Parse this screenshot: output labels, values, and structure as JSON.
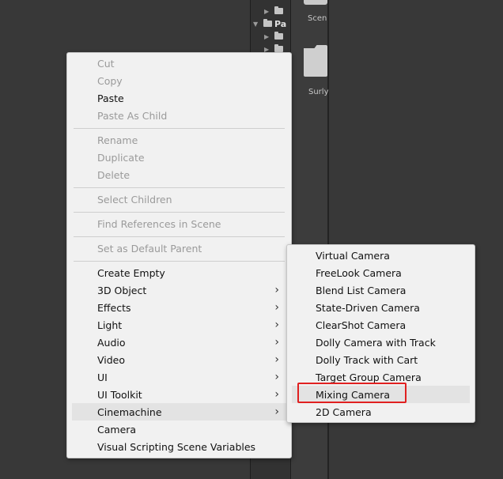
{
  "hierarchy": {
    "partial_label": "Pa"
  },
  "assets": {
    "items": [
      {
        "label": "Scen"
      },
      {
        "label": "Surly"
      }
    ]
  },
  "context_menu": {
    "groups": [
      [
        {
          "label": "Cut",
          "enabled": false
        },
        {
          "label": "Copy",
          "enabled": false
        },
        {
          "label": "Paste",
          "enabled": true
        },
        {
          "label": "Paste As Child",
          "enabled": false
        }
      ],
      [
        {
          "label": "Rename",
          "enabled": false
        },
        {
          "label": "Duplicate",
          "enabled": false
        },
        {
          "label": "Delete",
          "enabled": false
        }
      ],
      [
        {
          "label": "Select Children",
          "enabled": false
        }
      ],
      [
        {
          "label": "Find References in Scene",
          "enabled": false
        }
      ],
      [
        {
          "label": "Set as Default Parent",
          "enabled": false
        }
      ],
      [
        {
          "label": "Create Empty",
          "enabled": true,
          "submenu": false
        },
        {
          "label": "3D Object",
          "enabled": true,
          "submenu": true
        },
        {
          "label": "Effects",
          "enabled": true,
          "submenu": true
        },
        {
          "label": "Light",
          "enabled": true,
          "submenu": true
        },
        {
          "label": "Audio",
          "enabled": true,
          "submenu": true
        },
        {
          "label": "Video",
          "enabled": true,
          "submenu": true
        },
        {
          "label": "UI",
          "enabled": true,
          "submenu": true
        },
        {
          "label": "UI Toolkit",
          "enabled": true,
          "submenu": true
        },
        {
          "label": "Cinemachine",
          "enabled": true,
          "submenu": true,
          "hovered": true
        },
        {
          "label": "Camera",
          "enabled": true,
          "submenu": false
        },
        {
          "label": "Visual Scripting Scene Variables",
          "enabled": true,
          "submenu": false
        }
      ]
    ],
    "submenu_arrow": "›"
  },
  "cinemachine_submenu": {
    "items": [
      {
        "label": "Virtual Camera"
      },
      {
        "label": "FreeLook Camera"
      },
      {
        "label": "Blend List Camera"
      },
      {
        "label": "State-Driven Camera"
      },
      {
        "label": "ClearShot Camera"
      },
      {
        "label": "Dolly Camera with Track"
      },
      {
        "label": "Dolly Track with Cart"
      },
      {
        "label": "Target Group Camera"
      },
      {
        "label": "Mixing Camera",
        "hovered": true,
        "highlighted": true
      },
      {
        "label": "2D Camera"
      }
    ],
    "highlight_color": "#e02020"
  },
  "colors": {
    "menu_bg": "#f1f1f1",
    "disabled_text": "#9a9a9a",
    "enabled_text": "#111111",
    "hover_bg": "#e3e3e3",
    "editor_bg": "#383838"
  }
}
